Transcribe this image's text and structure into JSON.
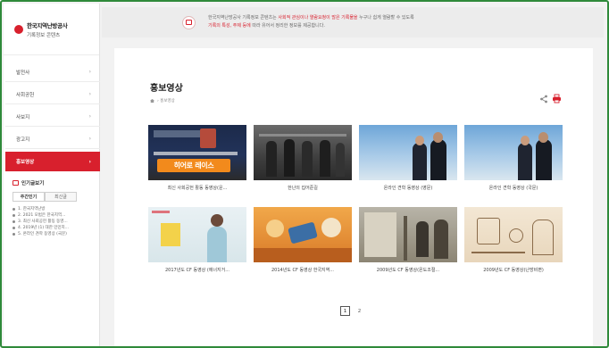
{
  "logo": {
    "title": "한국지역난방공사",
    "subtitle": "기록정보 콘텐츠"
  },
  "nav": [
    {
      "label": "발전사",
      "active": false
    },
    {
      "label": "사회공헌",
      "active": false
    },
    {
      "label": "사보지",
      "active": false
    },
    {
      "label": "광고지",
      "active": false
    },
    {
      "label": "홍보영상",
      "active": true
    }
  ],
  "popular": {
    "title": "인기글보기",
    "tabs": [
      "주간인기",
      "최신글"
    ],
    "items": [
      "1. 한국지역난방",
      "2. 2021 모범은 한국지역...",
      "3. 최신 사회공헌 활동 동영...",
      "4. 2019년 (1) 대한 민민지...",
      "5. 온라인 견학 동영상 (국문)"
    ]
  },
  "notice": {
    "line1_a": "한국지역난방공사 기록정보 콘텐츠는 ",
    "line1_hl": "사회적 관심이나 열람요청이 많은 기록물을",
    "line1_b": " 누구나 쉽게 열람할 수 있도록",
    "line2_hl": "기록의 특성, 주제 등에",
    "line2_b": " 따라 유어서 정리한 정보를 제공합니다."
  },
  "page": {
    "title": "홍보영상",
    "breadcrumb": "홍보영상"
  },
  "videos": [
    {
      "caption": "최신 사회공헌 활동 동영상(운...",
      "overlay": "히어로 레이스"
    },
    {
      "caption": "한난의 집어준길",
      "overlay": ""
    },
    {
      "caption": "온라인 견학 동영상 (영문)",
      "overlay": ""
    },
    {
      "caption": "온라인 견학 동영상 (국문)",
      "overlay": ""
    },
    {
      "caption": "2017년도 CF 동영상 (에너지거...",
      "overlay": ""
    },
    {
      "caption": "2014년도 CF 동영상 한국지역...",
      "overlay": ""
    },
    {
      "caption": "2009년도 CF 동영상(온도조절...",
      "overlay": ""
    },
    {
      "caption": "2009년도 CF 동영상(난방비편)",
      "overlay": ""
    }
  ],
  "pagination": {
    "pages": [
      "1",
      "2"
    ],
    "current": "1"
  },
  "colors": {
    "accent": "#d8202d",
    "frame": "#2f8a3a"
  }
}
